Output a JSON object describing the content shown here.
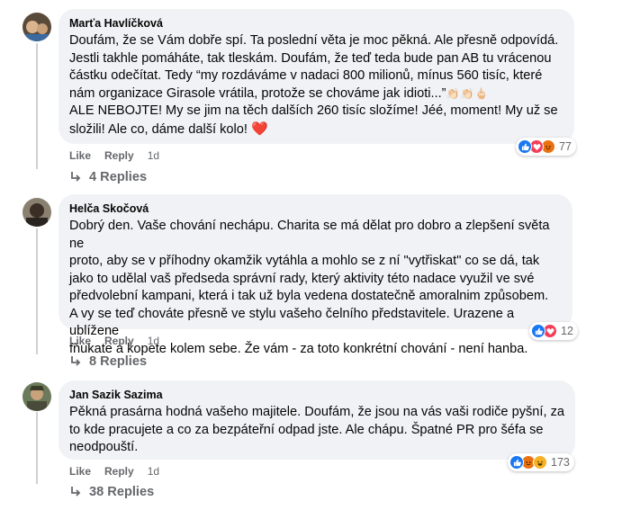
{
  "comments": [
    {
      "author": "Marťa Havlíčková",
      "text": "Doufám, že se Vám dobře spí. Ta poslední věta je moc pěkná. Ale přesně odpovídá.\nJestli takhle pomáháte, tak tleskám. Doufám, že teď teda bude pan AB tu vrácenou\nčástku odečítat. Tedy “my rozdáváme v nadaci 800 milionů, mínus 560 tisíc, které\nnám organizace Girasole vrátila, protože se chováme jak idioti...”",
      "emoji_tail": "👏🏻👏🏻🖕🏻",
      "text2": "ALE NEBOJTE! My se jim na těch dalších 260 tisíc složíme! Jéé, moment! My už se\nsložili! Ale co, dáme další kolo!",
      "heart": "❤️",
      "reaction_count": "77",
      "like_label": "Like",
      "reply_label": "Reply",
      "time": "1d",
      "replies_label": "4 Replies"
    },
    {
      "author": "Helča Skočová",
      "text": "Dobrý den. Vaše chování nechápu. Charita se má dělat pro dobro a zlepšení světa ne\nproto, aby se v příhodny okamžik vytáhla a mohlo se z ní \"vytřiskat\" co se dá, tak\njako to udělal vaš předseda správní rady, který aktivity této nadace využil ve své\npředvolební kampani, která i tak už byla vedena dostatečně amoralnim způsobem.\nA vy se teď chováte přesně ve stylu vašeho čelního představitele. Urazene a ublížene\nfňukate a kopete kolem sebe. Že vám - za toto konkrétní chování - není hanba.",
      "reaction_count": "12",
      "like_label": "Like",
      "reply_label": "Reply",
      "time": "1d",
      "replies_label": "8 Replies"
    },
    {
      "author": "Jan Sazik Sazima",
      "text": "Pěkná prasárna hodná vašeho majitele. Doufám, že jsou na vás vaši rodiče pyšní, za\nto kde pracujete a co za bezpáteřní odpad jste. Ale chápu. Špatné PR pro šéfa se\nneodpouští.",
      "reaction_count": "173",
      "like_label": "Like",
      "reply_label": "Reply",
      "time": "1d",
      "replies_label": "38 Replies"
    }
  ],
  "colors": {
    "bubble": "#f0f2f5",
    "meta": "#65676b",
    "like": "#1877f2",
    "love": "#f33e58",
    "angry": "#e9710f",
    "haha": "#f7b125"
  }
}
